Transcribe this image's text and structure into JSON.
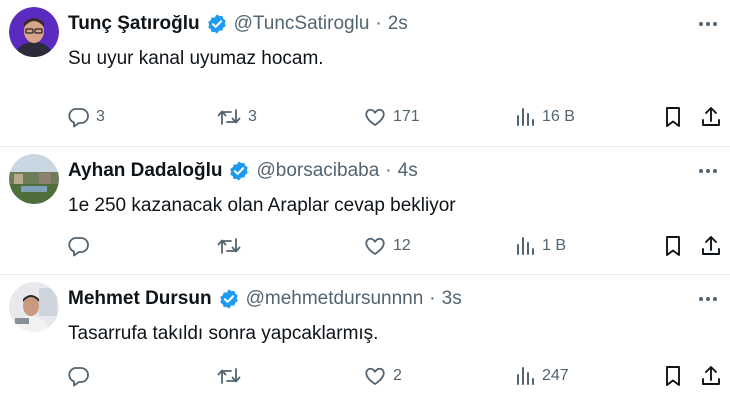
{
  "colors": {
    "verified": "#1d9bf0",
    "text": "#0f1419",
    "muted": "#536471",
    "divider": "#e6ecf0"
  },
  "tweets": [
    {
      "name": "Tunç Şatıroğlu",
      "handle": "@TuncSatiroglu",
      "separator": "·",
      "time": "2s",
      "text": "Su uyur kanal uyumaz hocam.",
      "replies": "3",
      "retweets": "3",
      "likes": "171",
      "views": "16 B"
    },
    {
      "name": "Ayhan Dadaloğlu",
      "handle": "@borsacibaba",
      "separator": "·",
      "time": "4s",
      "text": "1e 250 kazanacak olan Araplar cevap bekliyor",
      "replies": "",
      "retweets": "",
      "likes": "12",
      "views": "1 B"
    },
    {
      "name": "Mehmet Dursun",
      "handle": "@mehmetdursunnnn",
      "separator": "·",
      "time": "3s",
      "text": "Tasarrufa takıldı sonra yapcaklarmış.",
      "replies": "",
      "retweets": "",
      "likes": "2",
      "views": "247"
    }
  ]
}
